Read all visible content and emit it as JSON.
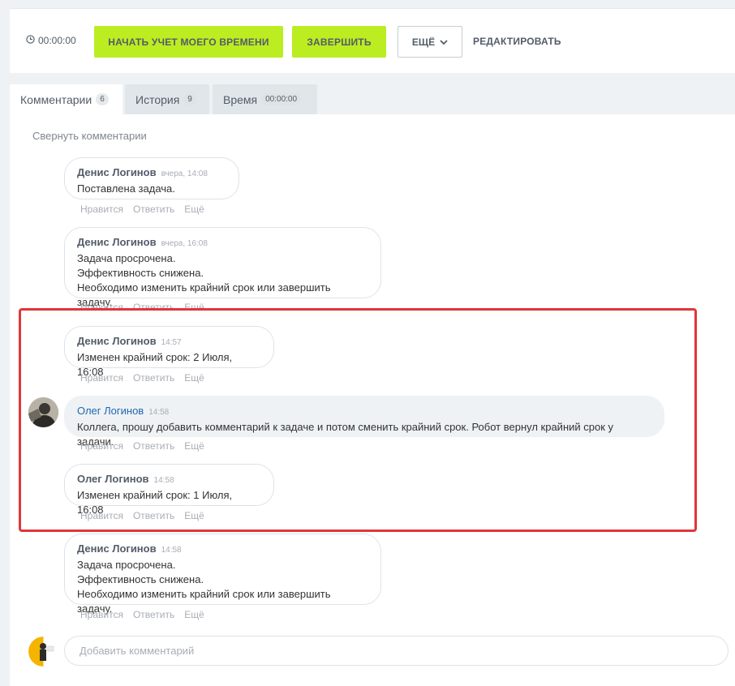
{
  "toolbar": {
    "timer": "00:00:00",
    "start_tracking": "НАЧАТЬ УЧЕТ МОЕГО ВРЕМЕНИ",
    "finish": "ЗАВЕРШИТЬ",
    "more": "ЕЩЁ",
    "edit": "РЕДАКТИРОВАТЬ"
  },
  "tabs": [
    {
      "label": "Комментарии",
      "count": "6"
    },
    {
      "label": "История",
      "count": "9"
    },
    {
      "label": "Время",
      "count": "00:00:00"
    }
  ],
  "collapse_label": "Свернуть комментарии",
  "actions": {
    "like": "Нравится",
    "reply": "Ответить",
    "more": "Ещё"
  },
  "comments": [
    {
      "author": "Денис Логинов",
      "time": "вчера, 14:08",
      "lines": [
        "Поставлена задача."
      ]
    },
    {
      "author": "Денис Логинов",
      "time": "вчера, 16:08",
      "lines": [
        "Задача просрочена.",
        "Эффективность снижена.",
        "Необходимо изменить крайний срок или завершить задачу."
      ]
    },
    {
      "author": "Денис Логинов",
      "time": "14:57",
      "lines": [
        "Изменен крайний срок: 2 Июля, 16:08"
      ]
    },
    {
      "author": "Олег Логинов",
      "time": "14:58",
      "lines": [
        "Коллега, прошу добавить комментарий к задаче и потом сменить крайний срок. Робот вернул крайний срок у задачи."
      ]
    },
    {
      "author": "Олег Логинов",
      "time": "14:58",
      "lines": [
        "Изменен крайний срок: 1 Июля, 16:08"
      ]
    },
    {
      "author": "Денис Логинов",
      "time": "14:58",
      "lines": [
        "Задача просрочена.",
        "Эффективность снижена.",
        "Необходимо изменить крайний срок или завершить задачу."
      ]
    }
  ],
  "comment_input": {
    "placeholder": "Добавить комментарий"
  },
  "colors": {
    "accent_green": "#bbed21",
    "highlight_red": "#e0363b",
    "link_blue": "#2067b0"
  }
}
